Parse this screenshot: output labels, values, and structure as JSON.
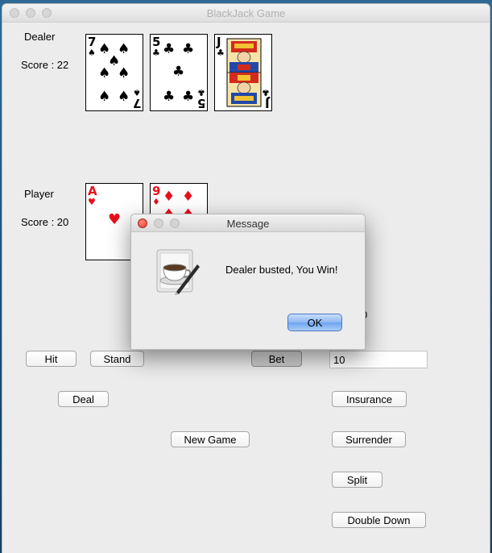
{
  "window": {
    "title": "BlackJack Game"
  },
  "dealer": {
    "label": "Dealer",
    "score_label": "Score : 22",
    "cards": [
      {
        "rank": "7",
        "suit": "spade",
        "color": "black"
      },
      {
        "rank": "5",
        "suit": "club",
        "color": "black"
      },
      {
        "rank": "J",
        "suit": "club",
        "color": "black",
        "face": true
      }
    ]
  },
  "player": {
    "label": "Player",
    "score_label": "Score : 20",
    "cards": [
      {
        "rank": "A",
        "suit": "heart",
        "color": "red"
      },
      {
        "rank": "9",
        "suit": "diamond",
        "color": "red"
      }
    ]
  },
  "controls": {
    "hit": "Hit",
    "stand": "Stand",
    "bet": "Bet",
    "bet_value": "10",
    "deal": "Deal",
    "insurance": "Insurance",
    "new_game": "New Game",
    "surrender": "Surrender",
    "split": "Split",
    "double_down": "Double Down",
    "hidden_digit": "0"
  },
  "dialog": {
    "title": "Message",
    "message": "Dealer busted, You Win!",
    "ok": "OK",
    "icon": "java-coffee-cup-icon"
  }
}
